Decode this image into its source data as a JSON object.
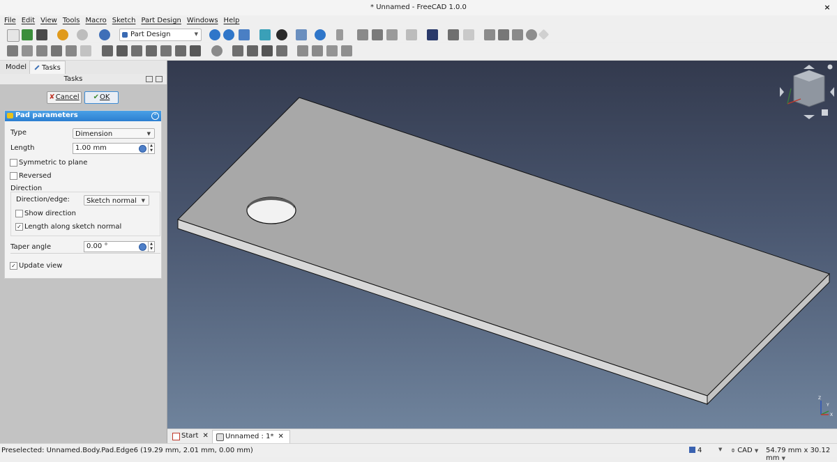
{
  "window": {
    "title": "* Unnamed - FreeCAD 1.0.0",
    "close": "×"
  },
  "menu": [
    "File",
    "Edit",
    "View",
    "Tools",
    "Macro",
    "Sketch",
    "Part Design",
    "Windows",
    "Help"
  ],
  "toolbar": {
    "workbench": "Part Design"
  },
  "left_panel": {
    "tabs": {
      "model": "Model",
      "tasks": "Tasks"
    },
    "tasks_title": "Tasks",
    "cancel": "Cancel",
    "ok": "OK",
    "pad": {
      "title": "Pad parameters",
      "type_label": "Type",
      "type_value": "Dimension",
      "length_label": "Length",
      "length_value": "1.00 mm",
      "symmetric": "Symmetric to plane",
      "reversed": "Reversed",
      "direction": "Direction",
      "direction_edge_label": "Direction/edge:",
      "direction_edge_value": "Sketch normal",
      "show_direction": "Show direction",
      "length_along_normal": "Length along sketch normal",
      "taper_label": "Taper angle",
      "taper_value": "0.00 °",
      "update_view": "Update view"
    }
  },
  "viewport": {
    "axes": {
      "z": "Z",
      "y": "Y",
      "x": "X"
    }
  },
  "doc_tabs": {
    "start": "Start",
    "unnamed": "Unnamed : 1*",
    "close": "✕"
  },
  "status": {
    "message": "Preselected: Unnamed.Body.Pad.Edge6 (19.29 mm, 2.01 mm, 0.00 mm)",
    "count": "4",
    "nav": "CAD",
    "dims": "54.79 mm x 30.12 mm"
  },
  "colors": {
    "accent": "#2c7fd1",
    "plate": "#a9a9a9",
    "viewport_top": "#333a4e",
    "viewport_bottom": "#6f839c"
  }
}
